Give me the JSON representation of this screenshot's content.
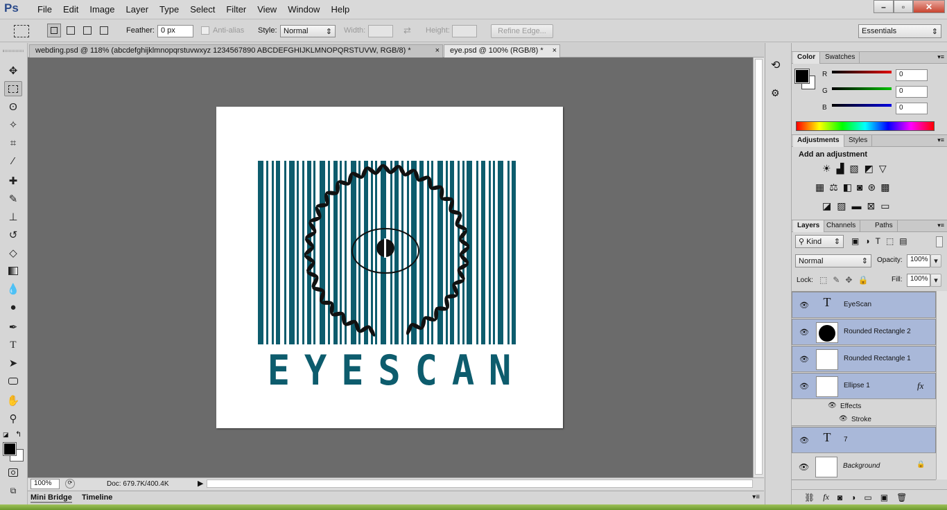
{
  "app": {
    "logo": "Ps"
  },
  "menu": [
    "File",
    "Edit",
    "Image",
    "Layer",
    "Type",
    "Select",
    "Filter",
    "View",
    "Window",
    "Help"
  ],
  "window_controls": {
    "minimize": "–",
    "restore": "▫",
    "close": "✕"
  },
  "options": {
    "feather_label": "Feather:",
    "feather_value": "0 px",
    "antialias_label": "Anti-alias",
    "style_label": "Style:",
    "style_value": "Normal",
    "width_label": "Width:",
    "height_label": "Height:",
    "refine_edge": "Refine Edge...",
    "workspace": "Essentials"
  },
  "tabs": [
    {
      "label": "webding.psd @ 118% (abcdefghijklmnopqrstuvwxyz  1234567890  ABCDEFGHIJKLMNOPQRSTUVW, RGB/8) *",
      "close": "×"
    },
    {
      "label": "eye.psd @ 100% (RGB/8) *",
      "close": "×"
    }
  ],
  "document": {
    "logo_text": "EYESCAN",
    "brand_color": "#0d5c6d"
  },
  "status": {
    "zoom": "100%",
    "doc": "Doc: 679.7K/400.4K"
  },
  "bottom_tabs": [
    "Mini Bridge",
    "Timeline"
  ],
  "color_panel": {
    "tabs": [
      "Color",
      "Swatches"
    ],
    "channels": [
      {
        "label": "R",
        "value": "0",
        "color": "#e00000"
      },
      {
        "label": "G",
        "value": "0",
        "color": "#00b000"
      },
      {
        "label": "B",
        "value": "0",
        "color": "#0000d0"
      }
    ]
  },
  "adjustments_panel": {
    "tabs": [
      "Adjustments",
      "Styles"
    ],
    "heading": "Add an adjustment"
  },
  "layers_panel": {
    "tabs": [
      "Layers",
      "Channels",
      "Paths"
    ],
    "kind": "Kind",
    "blend_mode": "Normal",
    "opacity_label": "Opacity:",
    "opacity_value": "100%",
    "lock_label": "Lock:",
    "fill_label": "Fill:",
    "fill_value": "100%",
    "fx_glyph": "fx",
    "layers": [
      {
        "name": "EyeScan",
        "kind": "text",
        "selected": true
      },
      {
        "name": "Rounded Rectangle 2",
        "kind": "shape",
        "selected": true
      },
      {
        "name": "Rounded Rectangle 1",
        "kind": "shape",
        "selected": true
      },
      {
        "name": "Ellipse 1",
        "kind": "shape",
        "selected": true
      },
      {
        "name": "7",
        "kind": "text",
        "selected": true
      },
      {
        "name": "Background",
        "kind": "pixel",
        "selected": false
      }
    ],
    "effects_label": "Effects",
    "stroke_label": "Stroke"
  },
  "icons": {
    "move": "move-icon",
    "marquee": "rect-marquee-icon",
    "lasso": "lasso-icon",
    "quick_select": "quick-select-icon",
    "crop": "crop-icon",
    "eyedropper": "eyedropper-icon",
    "heal": "healing-brush-icon",
    "brush": "brush-icon",
    "stamp": "clone-stamp-icon",
    "history_brush": "history-brush-icon",
    "eraser": "eraser-icon",
    "gradient": "gradient-icon",
    "blur": "blur-icon",
    "dodge": "dodge-icon",
    "pen": "pen-icon",
    "type": "type-icon",
    "path_select": "path-select-icon",
    "shape": "shape-icon",
    "hand": "hand-icon",
    "zoom": "zoom-icon"
  }
}
